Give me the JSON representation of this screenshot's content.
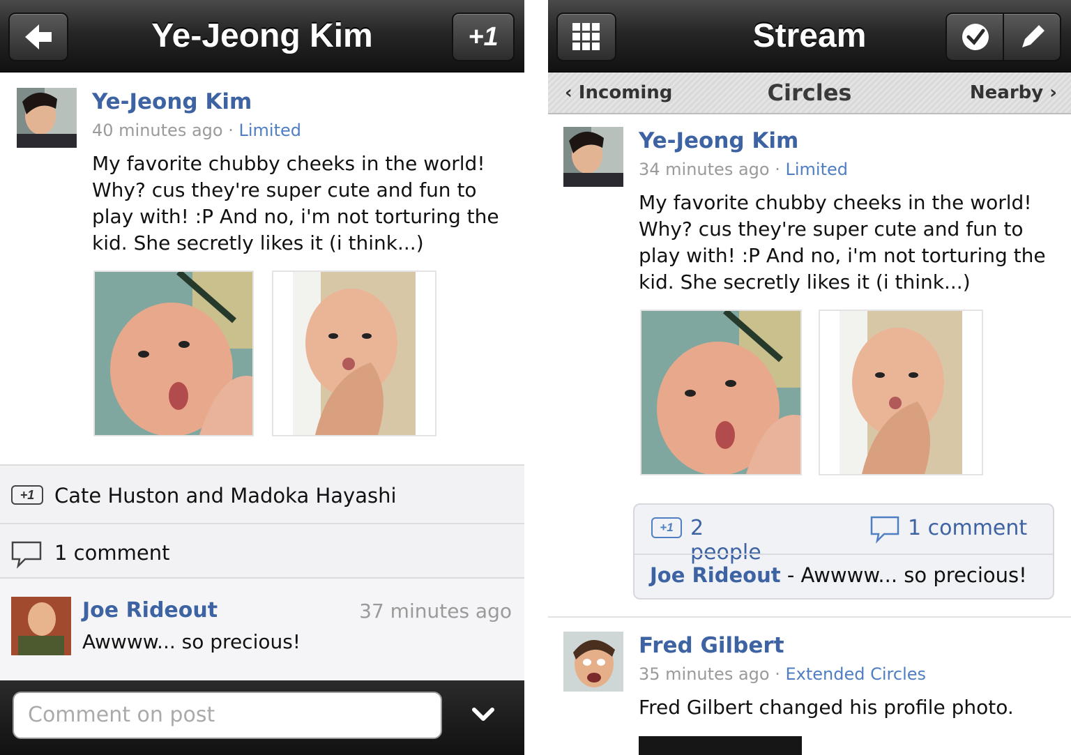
{
  "left_screen": {
    "header": {
      "title": "Ye-Jeong Kim",
      "back_icon": "back-arrow-icon",
      "plus_one_label": "+1"
    },
    "post": {
      "author": "Ye-Jeong Kim",
      "time": "40 minutes ago",
      "separator": "·",
      "visibility": "Limited",
      "text": "My favorite chubby cheeks in the world! Why? cus they're super cute and fun to play with! :P And no, i'm not torturing the kid. She secretly likes it (i think...)"
    },
    "plus_ones": {
      "icon_text": "+1",
      "label": "Cate Huston and Madoka Hayashi"
    },
    "comments": {
      "label": "1 comment"
    },
    "comment": {
      "author": "Joe Rideout",
      "time": "37 minutes ago",
      "text": "Awwww... so precious!"
    },
    "comment_input": {
      "placeholder": "Comment on post"
    }
  },
  "right_screen": {
    "header": {
      "title": "Stream"
    },
    "tabs": {
      "left": "Incoming",
      "center": "Circles",
      "right": "Nearby"
    },
    "post": {
      "author": "Ye-Jeong Kim",
      "time": "34 minutes ago",
      "separator": "·",
      "visibility": "Limited",
      "text": "My favorite chubby cheeks in the world! Why? cus they're super cute and fun to play with! :P And no, i'm not torturing the kid. She secretly likes it (i think...)",
      "plus_icon_text": "+1",
      "plus_label": "2 people",
      "comment_label": "1 comment",
      "preview_author": "Joe Rideout",
      "preview_dash": "-",
      "preview_text": "Awwww... so precious!"
    },
    "post2": {
      "author": "Fred Gilbert",
      "time": "35 minutes ago",
      "separator": "·",
      "visibility": "Extended Circles",
      "text": "Fred Gilbert changed his profile photo."
    }
  },
  "colors": {
    "link": "#3d63a3",
    "visibility": "#4f7ec2",
    "header": "#1e1e1e"
  }
}
